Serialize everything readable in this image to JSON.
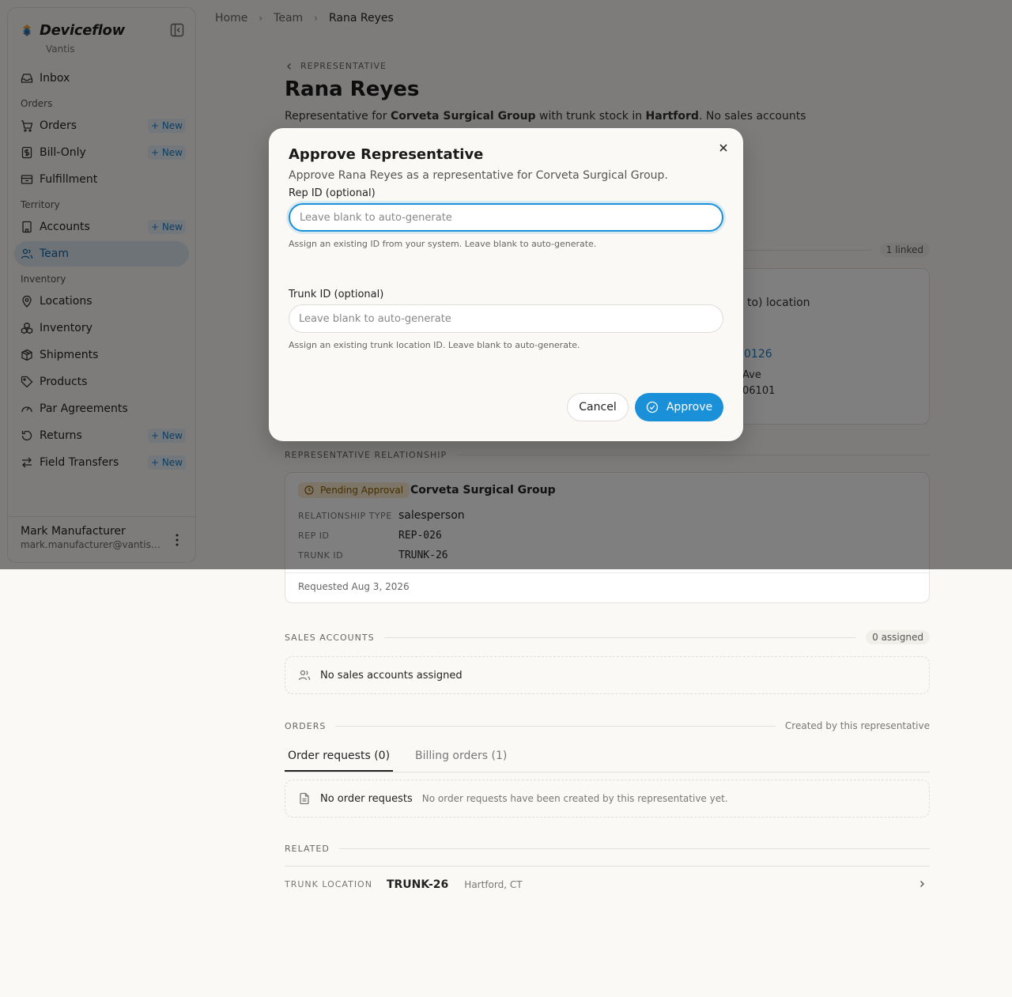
{
  "sidebar": {
    "brand": "Deviceflow",
    "org": "Vantis",
    "inbox": "Inbox",
    "sections": {
      "orders": "Orders",
      "territory": "Territory",
      "inventory": "Inventory"
    },
    "items": {
      "orders": "Orders",
      "bill_only": "Bill-Only",
      "fulfillment": "Fulfillment",
      "accounts": "Accounts",
      "team": "Team",
      "locations": "Locations",
      "inventory": "Inventory",
      "shipments": "Shipments",
      "products": "Products",
      "par_agreements": "Par Agreements",
      "returns": "Returns",
      "field_transfers": "Field Transfers"
    },
    "new_label": "+ New",
    "user": {
      "name": "Mark Manufacturer",
      "email": "mark.manufacturer@vantismedi..."
    },
    "accent": "#1a7cc7"
  },
  "breadcrumb": {
    "home": "Home",
    "team": "Team",
    "current": "Rana Reyes"
  },
  "page": {
    "back_label": "REPRESENTATIVE",
    "title": "Rana Reyes",
    "desc_prefix": "Representative for ",
    "desc_org": "Corveta Surgical Group",
    "desc_mid": " with trunk stock in ",
    "desc_city": "Hartford",
    "desc_suffix": ". No sales accounts"
  },
  "location": {
    "count": "1 linked",
    "partial_type": "to) location",
    "partial_id": "0126",
    "partial_street": "Ave",
    "partial_zip": "06101"
  },
  "relationship": {
    "heading": "REPRESENTATIVE RELATIONSHIP",
    "status": "Pending Approval",
    "org": "Corveta Surgical Group",
    "type_label": "RELATIONSHIP TYPE",
    "type_value": "salesperson",
    "rep_label": "REP ID",
    "rep_value": "REP-026",
    "trunk_label": "TRUNK ID",
    "trunk_value": "TRUNK-26",
    "requested": "Requested Aug 3, 2026"
  },
  "sales_accounts": {
    "heading": "SALES ACCOUNTS",
    "count": "0 assigned",
    "empty": "No sales accounts assigned"
  },
  "orders": {
    "heading": "ORDERS",
    "note": "Created by this representative",
    "tabs": [
      "Order requests (0)",
      "Billing orders (1)"
    ],
    "empty_title": "No order requests",
    "empty_sub": "No order requests have been created by this representative yet."
  },
  "related": {
    "heading": "RELATED",
    "label": "TRUNK LOCATION",
    "id": "TRUNK-26",
    "place": "Hartford, CT"
  },
  "modal": {
    "title": "Approve Representative",
    "desc": "Approve Rana Reyes as a representative for Corveta Surgical Group.",
    "rep_label": "Rep ID (optional)",
    "rep_value": "",
    "rep_placeholder": "Leave blank to auto-generate",
    "rep_hint": "Assign an existing ID from your system. Leave blank to auto-generate.",
    "trunk_label": "Trunk ID (optional)",
    "trunk_value": "",
    "trunk_placeholder": "Leave blank to auto-generate",
    "trunk_hint": "Assign an existing trunk location ID. Leave blank to auto-generate.",
    "cancel": "Cancel",
    "approve": "Approve",
    "primary_color": "#1a90d9"
  }
}
